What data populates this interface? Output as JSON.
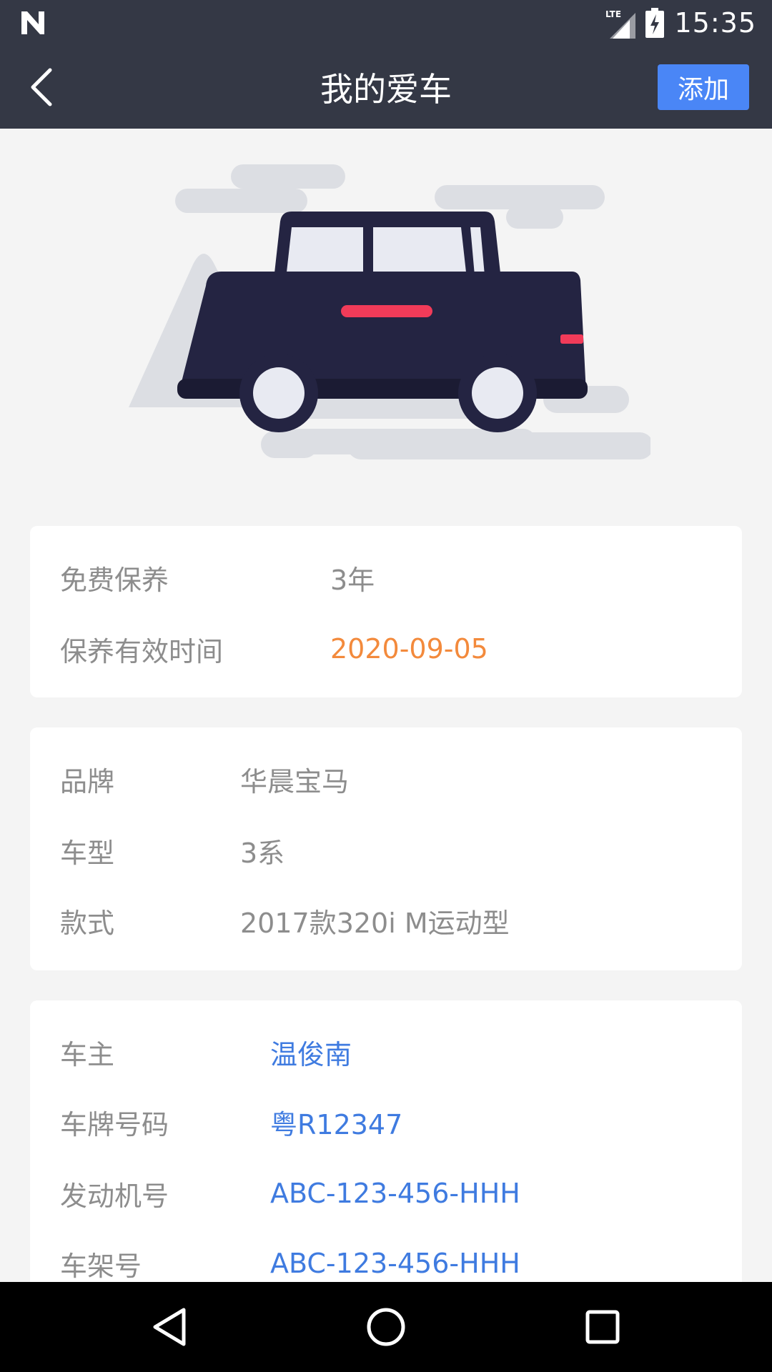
{
  "status_bar": {
    "network_label": "LTE",
    "time": "15:35"
  },
  "header": {
    "title": "我的爱车",
    "add_label": "添加"
  },
  "maintenance": {
    "free_label": "免费保养",
    "free_value": "3年",
    "valid_label": "保养有效时间",
    "valid_value": "2020-09-05"
  },
  "car_info": {
    "brand_label": "品牌",
    "brand_value": "华晨宝马",
    "model_label": "车型",
    "model_value": "3系",
    "style_label": "款式",
    "style_value": "2017款320i M运动型"
  },
  "owner_info": {
    "owner_label": "车主",
    "owner_value": "温俊南",
    "plate_label": "车牌号码",
    "plate_value": "粤R12347",
    "engine_label": "发动机号",
    "engine_value": "ABC-123-456-HHH",
    "frame_label": "车架号",
    "frame_value": "ABC-123-456-HHH"
  },
  "colors": {
    "bar": "#343845",
    "accent": "#4a86f6",
    "date": "#f38a3c",
    "link": "#3f7be0",
    "car_body": "#242442",
    "car_stripe": "#f13b59"
  },
  "icons": [
    "n-logo-icon",
    "signal-icon",
    "battery-charging-icon",
    "back-arrow-icon",
    "nav-back-icon",
    "nav-home-icon",
    "nav-recents-icon"
  ]
}
